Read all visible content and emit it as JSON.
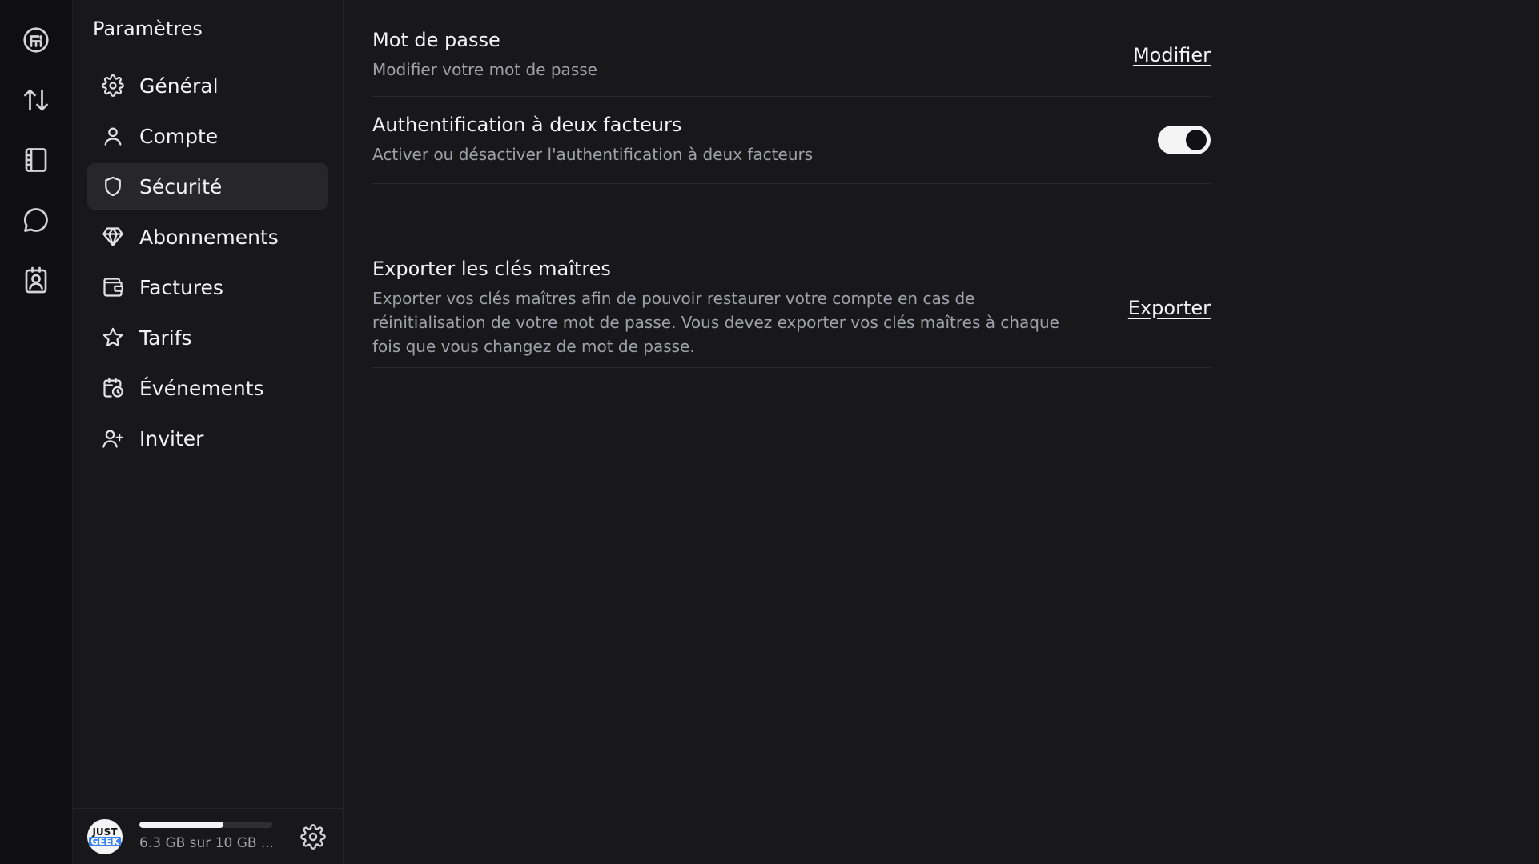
{
  "rail": {
    "items": [
      {
        "icon": "app-logo-icon"
      },
      {
        "icon": "transfer-icon"
      },
      {
        "icon": "notebook-icon"
      },
      {
        "icon": "chat-icon"
      },
      {
        "icon": "contact-card-icon"
      }
    ]
  },
  "sidebar": {
    "title": "Paramètres",
    "items": [
      {
        "label": "Général",
        "icon": "gear-icon"
      },
      {
        "label": "Compte",
        "icon": "user-icon"
      },
      {
        "label": "Sécurité",
        "icon": "shield-icon",
        "active": true
      },
      {
        "label": "Abonnements",
        "icon": "diamond-icon"
      },
      {
        "label": "Factures",
        "icon": "wallet-icon"
      },
      {
        "label": "Tarifs",
        "icon": "star-icon"
      },
      {
        "label": "Événements",
        "icon": "calendar-clock-icon"
      },
      {
        "label": "Inviter",
        "icon": "user-plus-icon"
      }
    ],
    "footer": {
      "avatar_top": "JUST",
      "avatar_bottom": "GEEK",
      "storage_text": "6.3 GB sur 10 GB ...",
      "storage_used_fraction": 0.63
    }
  },
  "main": {
    "password": {
      "title": "Mot de passe",
      "description": "Modifier votre mot de passe",
      "action": "Modifier"
    },
    "two_factor": {
      "title": "Authentification à deux facteurs",
      "description": "Activer ou désactiver l'authentification à deux facteurs",
      "enabled": true
    },
    "export_keys": {
      "title": "Exporter les clés maîtres",
      "description": "Exporter vos clés maîtres afin de pouvoir restaurer votre compte en cas de réinitialisation de votre mot de passe. Vous devez exporter vos clés maîtres à chaque fois que vous changez de mot de passe.",
      "action": "Exporter"
    }
  },
  "colors": {
    "background": "#18181b",
    "rail": "#0f0f11",
    "active_item": "#27272a",
    "text": "#f4f4f5",
    "muted": "#a1a1aa"
  }
}
